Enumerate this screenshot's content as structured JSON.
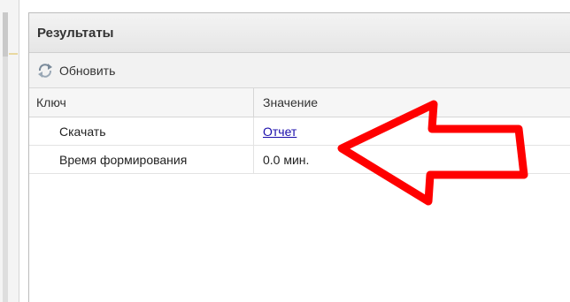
{
  "panel": {
    "title": "Результаты"
  },
  "toolbar": {
    "refresh_label": "Обновить",
    "refresh_icon": "refresh-icon"
  },
  "grid": {
    "columns": [
      "Ключ",
      "Значение"
    ],
    "rows": [
      {
        "key": "Скачать",
        "value": "Отчет",
        "value_is_link": true
      },
      {
        "key": "Время формирования",
        "value": "0.0 мин.",
        "value_is_link": false
      }
    ]
  },
  "annotation": {
    "type": "arrow",
    "color": "#ff0000",
    "points_to": "Отчет"
  },
  "colors": {
    "link": "#1a0dab",
    "arrow": "#ff0000",
    "header_bg": "#ececec"
  }
}
